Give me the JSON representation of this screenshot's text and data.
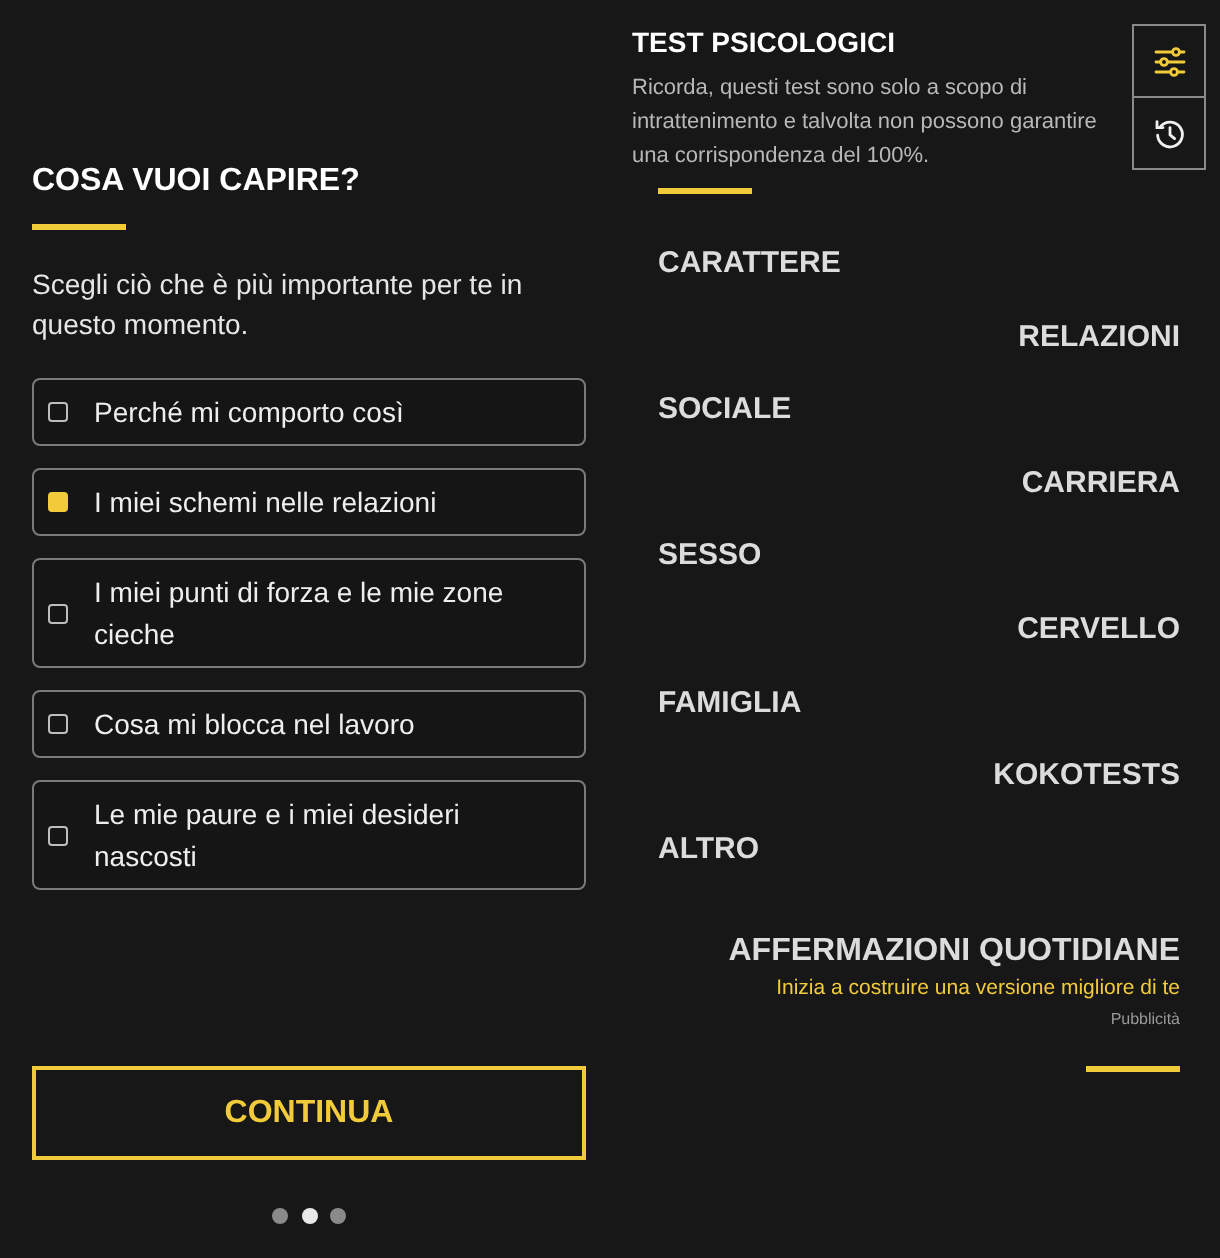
{
  "question": {
    "title": "COSA VUOI CAPIRE?",
    "subtitle": "Scegli ciò che è più importante per te in questo momento.",
    "options": [
      {
        "label": "Perché mi comporto così",
        "checked": false
      },
      {
        "label": "I miei schemi nelle relazioni",
        "checked": true
      },
      {
        "label": "I miei punti di forza e le mie zone cieche",
        "checked": false
      },
      {
        "label": "Cosa mi blocca nel lavoro",
        "checked": false
      },
      {
        "label": "Le mie paure e i miei desideri nascosti",
        "checked": false
      }
    ],
    "button": "CONTINUA",
    "pages": [
      {
        "selected": false
      },
      {
        "selected": true
      },
      {
        "selected": false
      }
    ]
  },
  "tests": {
    "title": "TEST PSICOLOGICI",
    "description": "Ricorda, questi test sono solo a scopo di intrattenimento e talvolta non possono garantire una corrispondenza del 100%.",
    "tools": [
      {
        "kind": "filter",
        "active": true
      },
      {
        "kind": "history",
        "active": false
      }
    ],
    "categories": [
      "CARATTERE",
      "RELAZIONI",
      "SOCIALE",
      "CARRIERA",
      "SESSO",
      "CERVELLO",
      "FAMIGLIA",
      "KOKOTESTS",
      "ALTRO"
    ],
    "ad": {
      "title": "AFFERMAZIONI QUOTIDIANE",
      "tagline": "Inizia a costruire una versione migliore di te",
      "label": "Pubblicità"
    }
  }
}
